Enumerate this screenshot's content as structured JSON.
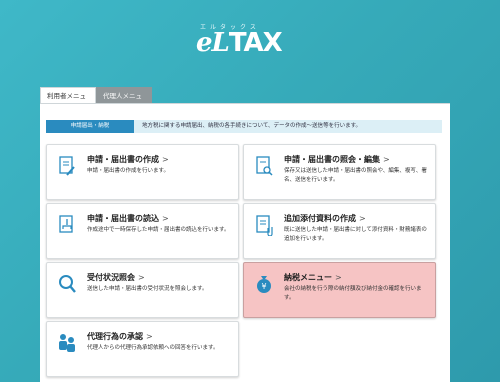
{
  "logo": {
    "ruby": "エルタックス",
    "mark_e": "eL",
    "mark_tax": "TAX"
  },
  "tabs": [
    {
      "label": "利用者メニュー",
      "active": true
    },
    {
      "label": "代理人メニュー",
      "active": false
    }
  ],
  "category": {
    "label": "申請届出・納税",
    "description": "地方税に関する申請届出、納税の各手続きについて、データの作成～送信等を行います。"
  },
  "cards": [
    {
      "title": "申請・届出書の作成",
      "body": "申請・届出書の作成を行います。",
      "icon": "document-pen-icon"
    },
    {
      "title": "申請・届出書の照会・編集",
      "body": "保存又は送信した申請・届出書の照会や、編集、複写、署名、送信を行います。",
      "icon": "document-search-icon"
    },
    {
      "title": "申請・届出書の読込",
      "body": "作成途中で一時保存した申請・届出書の読込を行います。",
      "icon": "document-upload-icon"
    },
    {
      "title": "追加添付資料の作成",
      "body": "既に送信した申請・届出書に対して添付資料・財務諸表の追加を行います。",
      "icon": "document-clip-icon"
    },
    {
      "title": "受付状況照会",
      "body": "送信した申請・届出書の受付状況を照会します。",
      "icon": "magnifier-icon"
    },
    {
      "title": "納税メニュー",
      "body": "会社の納税を行う際の納付額及び納付金の確認を行います。",
      "icon": "money-bag-icon"
    },
    {
      "title": "代理行為の承認",
      "body": "代理人からの代理行為承認依頼への回答を行います。",
      "icon": "people-icon"
    }
  ],
  "colors": {
    "background": "#36aab9",
    "accent": "#2a8bbf",
    "highlight_card": "#f6c4c4"
  }
}
